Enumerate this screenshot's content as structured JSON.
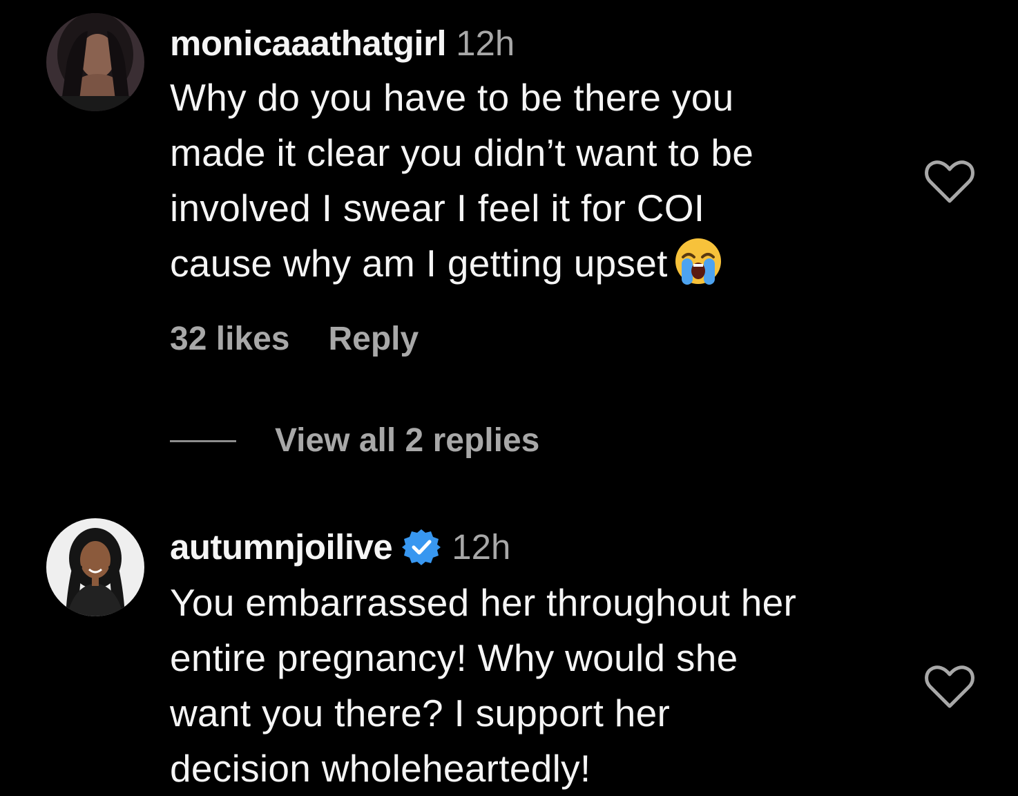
{
  "colors": {
    "background": "#000000",
    "primary_text": "#f5f5f5",
    "secondary_text": "#a8a8a8",
    "verified_badge": "#3897f0"
  },
  "comments": [
    {
      "username": "monicaaathatgirl",
      "timestamp": "12h",
      "verified": false,
      "text_lines": [
        "Why do you have to be there you",
        "made it clear you didn’t want to be",
        "involved I swear I feel it for COI",
        "cause why am I getting upset"
      ],
      "trailing_emoji": "loudly-crying-face",
      "likes": "32 likes",
      "reply_label": "Reply",
      "view_replies_label": "View all 2 replies",
      "like_icon": "heart-outline-icon"
    },
    {
      "username": "autumnjoilive",
      "timestamp": "12h",
      "verified": true,
      "verified_icon": "verified-badge-icon",
      "text_lines": [
        "You embarrassed her throughout her",
        "entire pregnancy! Why would she",
        "want you there? I support her",
        "decision wholeheartedly!"
      ],
      "like_icon": "heart-outline-icon"
    }
  ]
}
